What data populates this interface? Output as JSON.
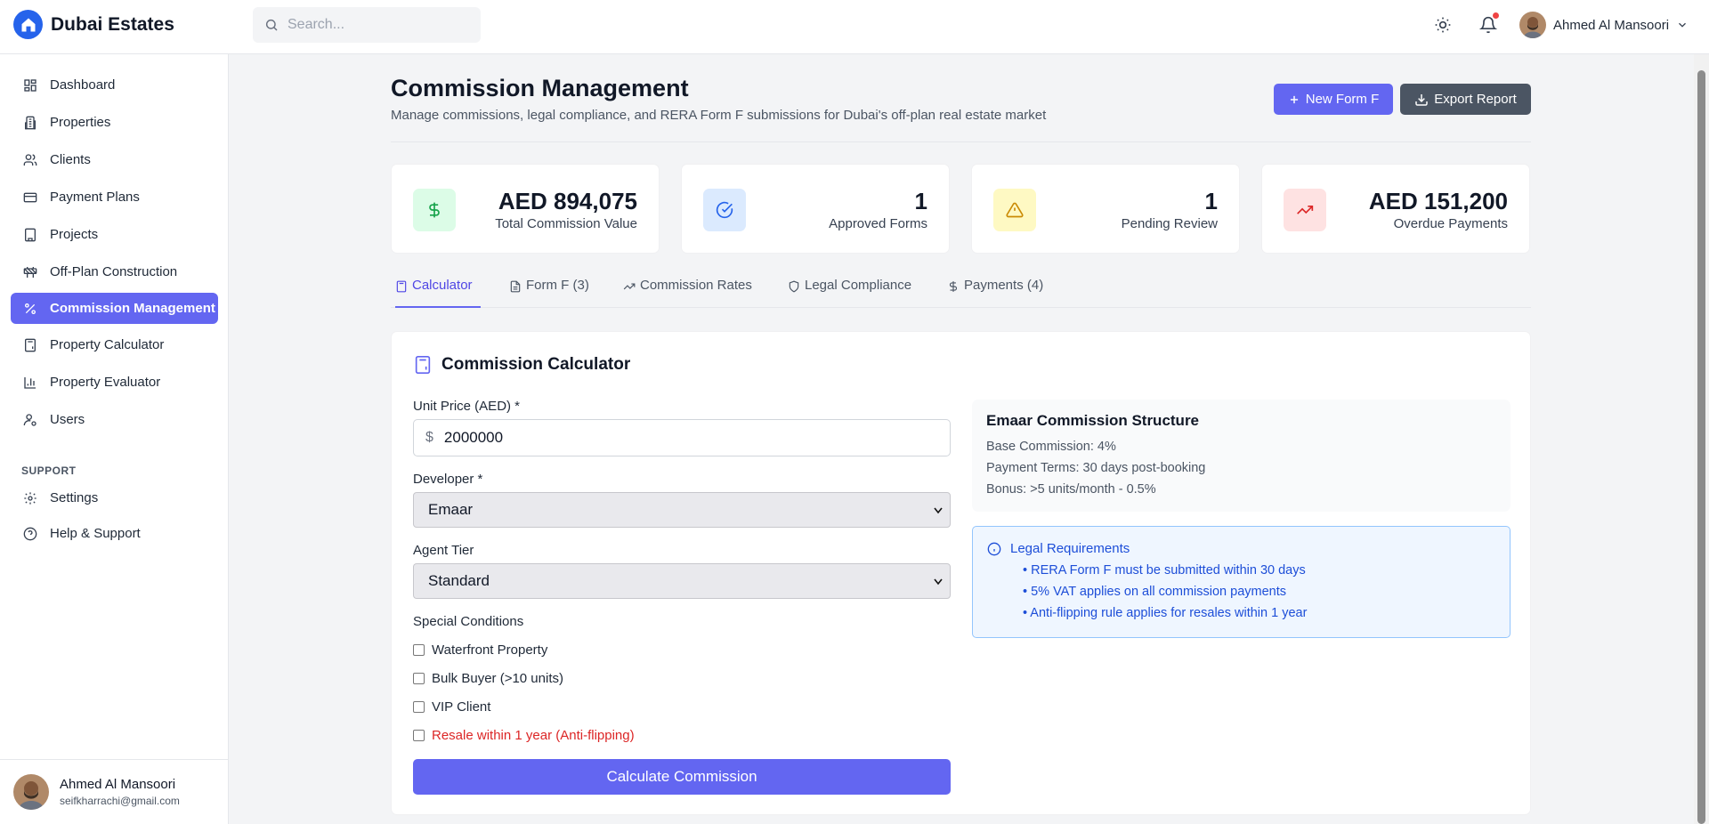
{
  "app": {
    "name": "Dubai Estates"
  },
  "search": {
    "placeholder": "Search..."
  },
  "header": {
    "user_name": "Ahmed Al Mansoori"
  },
  "sidebar": {
    "items": [
      {
        "label": "Dashboard",
        "icon": "dashboard-icon"
      },
      {
        "label": "Properties",
        "icon": "building-icon"
      },
      {
        "label": "Clients",
        "icon": "users-icon"
      },
      {
        "label": "Payment Plans",
        "icon": "credit-card-icon"
      },
      {
        "label": "Projects",
        "icon": "office-icon"
      },
      {
        "label": "Off-Plan Construction",
        "icon": "construction-icon"
      },
      {
        "label": "Commission Management",
        "icon": "percent-icon",
        "active": true
      },
      {
        "label": "Property Calculator",
        "icon": "calculator-icon"
      },
      {
        "label": "Property Evaluator",
        "icon": "bar-chart-icon"
      },
      {
        "label": "Users",
        "icon": "user-key-icon"
      }
    ],
    "support_heading": "SUPPORT",
    "support_items": [
      {
        "label": "Settings",
        "icon": "gear-icon"
      },
      {
        "label": "Help & Support",
        "icon": "help-circle-icon"
      }
    ],
    "user": {
      "name": "Ahmed Al Mansoori",
      "email": "seifkharrachi@gmail.com"
    }
  },
  "page": {
    "title": "Commission Management",
    "subtitle": "Manage commissions, legal compliance, and RERA Form F submissions for Dubai's off-plan real estate market",
    "new_button": "New Form F",
    "export_button": "Export Report"
  },
  "stats": [
    {
      "value": "AED 894,075",
      "label": "Total Commission Value",
      "icon": "dollar-icon",
      "bg": "#dcfce7",
      "color": "#16a34a"
    },
    {
      "value": "1",
      "label": "Approved Forms",
      "icon": "check-circle-icon",
      "bg": "#dbeafe",
      "color": "#2563eb"
    },
    {
      "value": "1",
      "label": "Pending Review",
      "icon": "warning-icon",
      "bg": "#fef9c3",
      "color": "#ca8a04"
    },
    {
      "value": "AED 151,200",
      "label": "Overdue Payments",
      "icon": "trending-up-icon",
      "bg": "#fee2e2",
      "color": "#dc2626"
    }
  ],
  "tabs": [
    {
      "label": "Calculator",
      "active": true
    },
    {
      "label": "Form F (3)"
    },
    {
      "label": "Commission Rates"
    },
    {
      "label": "Legal Compliance"
    },
    {
      "label": "Payments (4)"
    }
  ],
  "calculator": {
    "title": "Commission Calculator",
    "unit_price_label": "Unit Price (AED) *",
    "unit_price_prefix": "$",
    "unit_price_value": "2000000",
    "developer_label": "Developer *",
    "developer_value": "Emaar",
    "agent_tier_label": "Agent Tier",
    "agent_tier_value": "Standard",
    "special_conditions_label": "Special Conditions",
    "conditions": [
      {
        "label": "Waterfront Property",
        "checked": false
      },
      {
        "label": "Bulk Buyer (>10 units)",
        "checked": false
      },
      {
        "label": "VIP Client",
        "checked": false
      },
      {
        "label": "Resale within 1 year (Anti-flipping)",
        "checked": false
      }
    ],
    "submit": "Calculate Commission"
  },
  "structure": {
    "title": "Emaar Commission Structure",
    "lines": [
      "Base Commission: 4%",
      "Payment Terms: 30 days post-booking",
      "Bonus: >5 units/month - 0.5%"
    ]
  },
  "legal": {
    "title": "Legal Requirements",
    "items": [
      "• RERA Form F must be submitted within 30 days",
      "• 5% VAT applies on all commission payments",
      "• Anti-flipping rule applies for resales within 1 year"
    ]
  },
  "colors": {
    "accent": "#6366f1",
    "brand": "#2563eb",
    "danger": "#dc2626"
  }
}
